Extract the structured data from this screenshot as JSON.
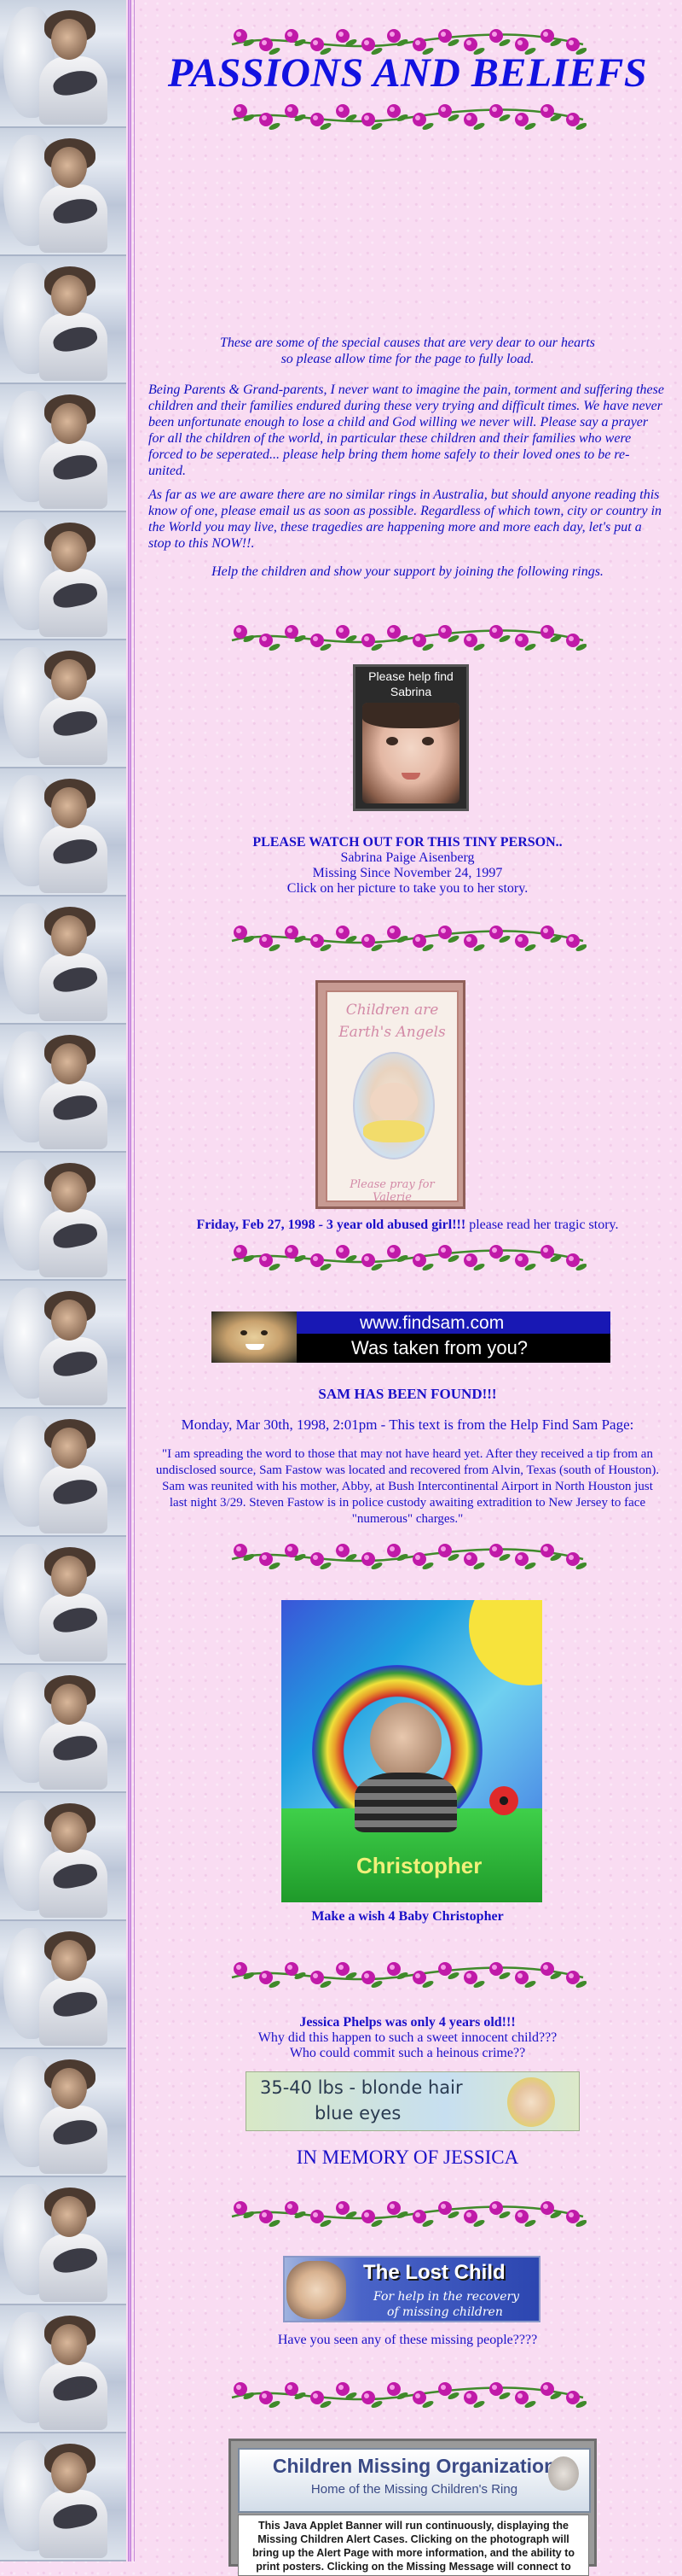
{
  "title": "PASSIONS AND BELIEFS",
  "intro": {
    "special_causes": "These are some of the special causes that are very dear to our hearts",
    "allow_time": "so please allow time for the page to fully load.",
    "parents": "Being Parents & Grand-parents, I never want to imagine the pain, torment and suffering these children and their families endured during these very trying and difficult times. We have never been unfortunate enough to lose a child and God willing we never will. Please say a prayer for all the children of the world, in particular these children and their families who were forced to be seperated... please help bring them home safely to their loved ones to be re-united.",
    "australia": "As far as we are aware there are no similar rings in Australia, but should anyone reading this know of one, please email us as soon as possible. Regardless of which town, city or country in the World you may live, these tragedies are happening more and more each day, let's put a stop to this NOW!!.",
    "help_children": "Help the children and show your support by joining the following rings."
  },
  "sabrina": {
    "image_text": "Please help find Sabrina",
    "heading": "PLEASE WATCH OUT FOR THIS TINY PERSON..",
    "name": "Sabrina Paige Aisenberg",
    "missing_since": "Missing Since November 24, 1997",
    "click_text": "Click on her picture to take you to her story."
  },
  "valerie": {
    "image_top_text": "Children are Earth's Angels",
    "image_bottom_text": "Please pray for Valerie",
    "caption_bold": "Friday, Feb 27, 1998 - 3 year old abused girl!!!",
    "caption_rest": " please read her tragic story."
  },
  "findsam": {
    "banner_url": "www.findsam.com",
    "banner_tagline": "Was taken from you?",
    "found_heading": "SAM HAS BEEN FOUND!!!",
    "date_line": "Monday, Mar 30th, 1998, 2:01pm - This text is from the Help Find Sam Page:",
    "quote": "\"I am spreading the word to those that may not have heard yet. After they received a tip from an undisclosed source, Sam Fastow was located and recovered from Alvin, Texas (south of Houston). Sam was reunited with his mother, Abby, at Bush Intercontinental Airport in North Houston just last night 3/29. Steven Fastow is in police custody awaiting extradition to New Jersey to face \"numerous\" charges.\""
  },
  "christopher": {
    "image_name": "Christopher",
    "caption": "Make a wish 4 Baby Christopher"
  },
  "jessica": {
    "heading": "Jessica Phelps was only 4 years old!!!",
    "line1": "Why did this happen to such a sweet innocent child???",
    "line2": "Who could commit such a heinous crime??",
    "banner_line1": "35-40 lbs - blonde hair",
    "banner_line2": "blue eyes",
    "memory": "IN MEMORY OF JESSICA"
  },
  "lost_child": {
    "banner_title": "The Lost Child",
    "banner_sub1": "For help in the recovery",
    "banner_sub2": "of missing children",
    "caption": "Have you seen any of these missing people????"
  },
  "cmo": {
    "title": "Children Missing Organization",
    "subtitle": "Home of the Missing Children's Ring",
    "body": "This Java Applet Banner will run continuously, displaying the Missing Children Alert Cases. Clicking on the photograph will bring up the Alert Page with more information, and the ability to print posters. Clicking on the Missing Message will connect to"
  },
  "colors": {
    "background": "#f9dcf2",
    "text_blue": "#1a10c8",
    "title_blue": "#1212e0",
    "flower_magenta": "#c01aa8",
    "leaf_green": "#3f8a2a"
  }
}
